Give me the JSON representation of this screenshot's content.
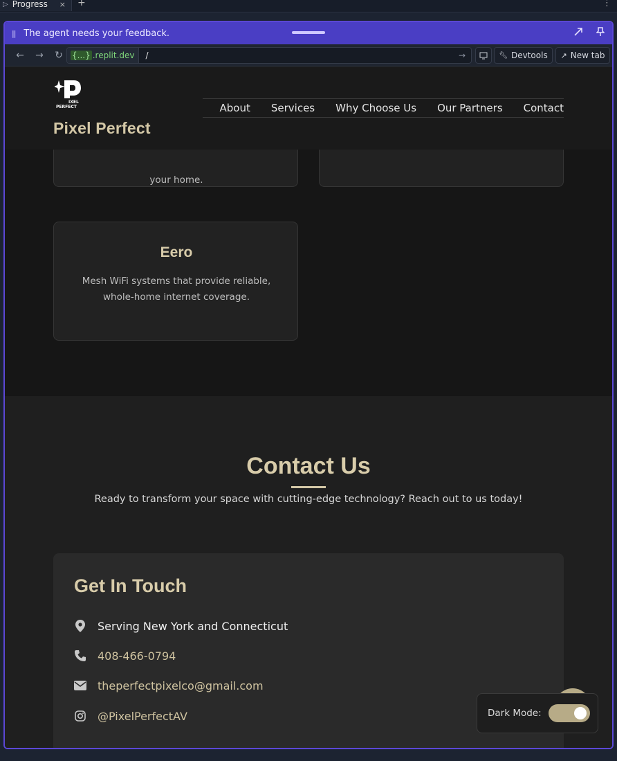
{
  "ide": {
    "tab_label": "Progress",
    "add_tab": "+",
    "close": "×",
    "kebab": "⋮"
  },
  "feedback_bar": {
    "message": "The agent needs your feedback.",
    "pause_glyph": "||"
  },
  "urlbar": {
    "host_braces": "{...}",
    "host_domain": ".replit.dev",
    "path": "/",
    "devtools_label": "Devtools",
    "new_tab_label": "New tab"
  },
  "site": {
    "brand": "Pixel Perfect",
    "logo_text": "PIXEL PERFECT",
    "nav": [
      "About",
      "Services",
      "Why Choose Us",
      "Our Partners",
      "Contact"
    ],
    "partner_cards": [
      {
        "title": "",
        "description_tail": "your home."
      },
      {
        "title": "",
        "description_tail": ""
      },
      {
        "title": "Eero",
        "description": "Mesh WiFi systems that provide reliable, whole-home internet coverage."
      }
    ],
    "contact": {
      "title": "Contact Us",
      "subtitle": "Ready to transform your space with cutting-edge technology? Reach out to us today!",
      "card_title": "Get In Touch",
      "rows": [
        {
          "icon": "map-pin-icon",
          "text": "Serving New York and Connecticut",
          "color": "#f0f0f0"
        },
        {
          "icon": "phone-icon",
          "text": "408-466-0794",
          "color": "#cfc3a0"
        },
        {
          "icon": "envelope-icon",
          "text": "theperfectpixelco@gmail.com",
          "color": "#cfc3a0"
        },
        {
          "icon": "instagram-icon",
          "text": "@PixelPerfectAV",
          "color": "#cfc3a0"
        }
      ]
    },
    "dark_mode": {
      "label": "Dark Mode:",
      "enabled": true
    }
  },
  "colors": {
    "accent": "#d3c7a6",
    "frame_border": "#5b47d6",
    "feedback_bg": "#4a3ec4",
    "page_bg": "#161616"
  }
}
